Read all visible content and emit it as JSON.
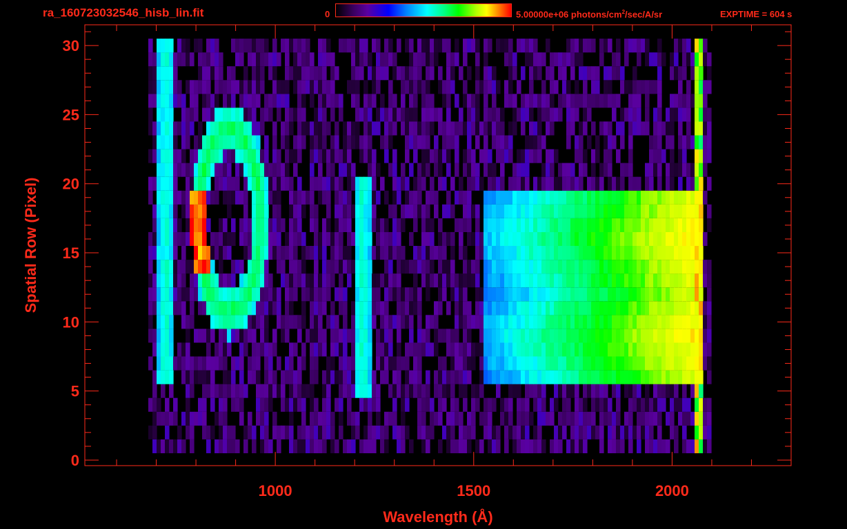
{
  "header": {
    "file_title": "ra_160723032546_hisb_lin.fit",
    "colorbar_min": "0",
    "colorbar_max": "5.00000e+06 photons/cm",
    "colorbar_max_exp": "2",
    "colorbar_max_units": "/sec/A/sr",
    "exptime": "EXPTIME = 604 s"
  },
  "colors": {
    "axis": "#ff2a1a",
    "background": "#000000",
    "colormap": [
      "#000000",
      "#3a0060",
      "#5a00a0",
      "#0000ff",
      "#0080ff",
      "#00ffff",
      "#00ff80",
      "#00ff00",
      "#b0ff00",
      "#ffff00",
      "#ff8000",
      "#ff0000"
    ]
  },
  "chart_data": {
    "type": "heatmap",
    "title": "ra_160723032546_hisb_lin.fit",
    "xlabel": "Wavelength (Å)",
    "ylabel": "Spatial Row (Pixel)",
    "xlim": [
      520,
      2300
    ],
    "ylim": [
      -0.4,
      31.5
    ],
    "x_ticks": [
      1000,
      1500,
      2000
    ],
    "y_ticks": [
      0,
      5,
      10,
      15,
      20,
      25,
      30
    ],
    "colorbar_range": [
      0,
      5000000
    ],
    "colorbar_units": "photons/cm^2/sec/A/sr",
    "data_extent": {
      "x": [
        680,
        2080
      ],
      "rows": [
        1,
        30
      ]
    },
    "features": [
      {
        "kind": "arc",
        "x_range": [
          790,
          960
        ],
        "rows": [
          11,
          24
        ],
        "peak_x": 800,
        "peak_rows": [
          14,
          19
        ]
      },
      {
        "kind": "vertical_line",
        "x": 1215,
        "rows": [
          5,
          20
        ]
      },
      {
        "kind": "vertical_line",
        "x": 720,
        "rows": [
          6,
          30
        ]
      },
      {
        "kind": "band",
        "x_range": [
          1600,
          2070
        ],
        "rows": [
          12,
          20
        ]
      },
      {
        "kind": "band",
        "x_range": [
          1600,
          2070
        ],
        "rows": [
          6,
          12
        ]
      },
      {
        "kind": "edge",
        "x": 2065,
        "rows": [
          1,
          30
        ]
      }
    ]
  }
}
